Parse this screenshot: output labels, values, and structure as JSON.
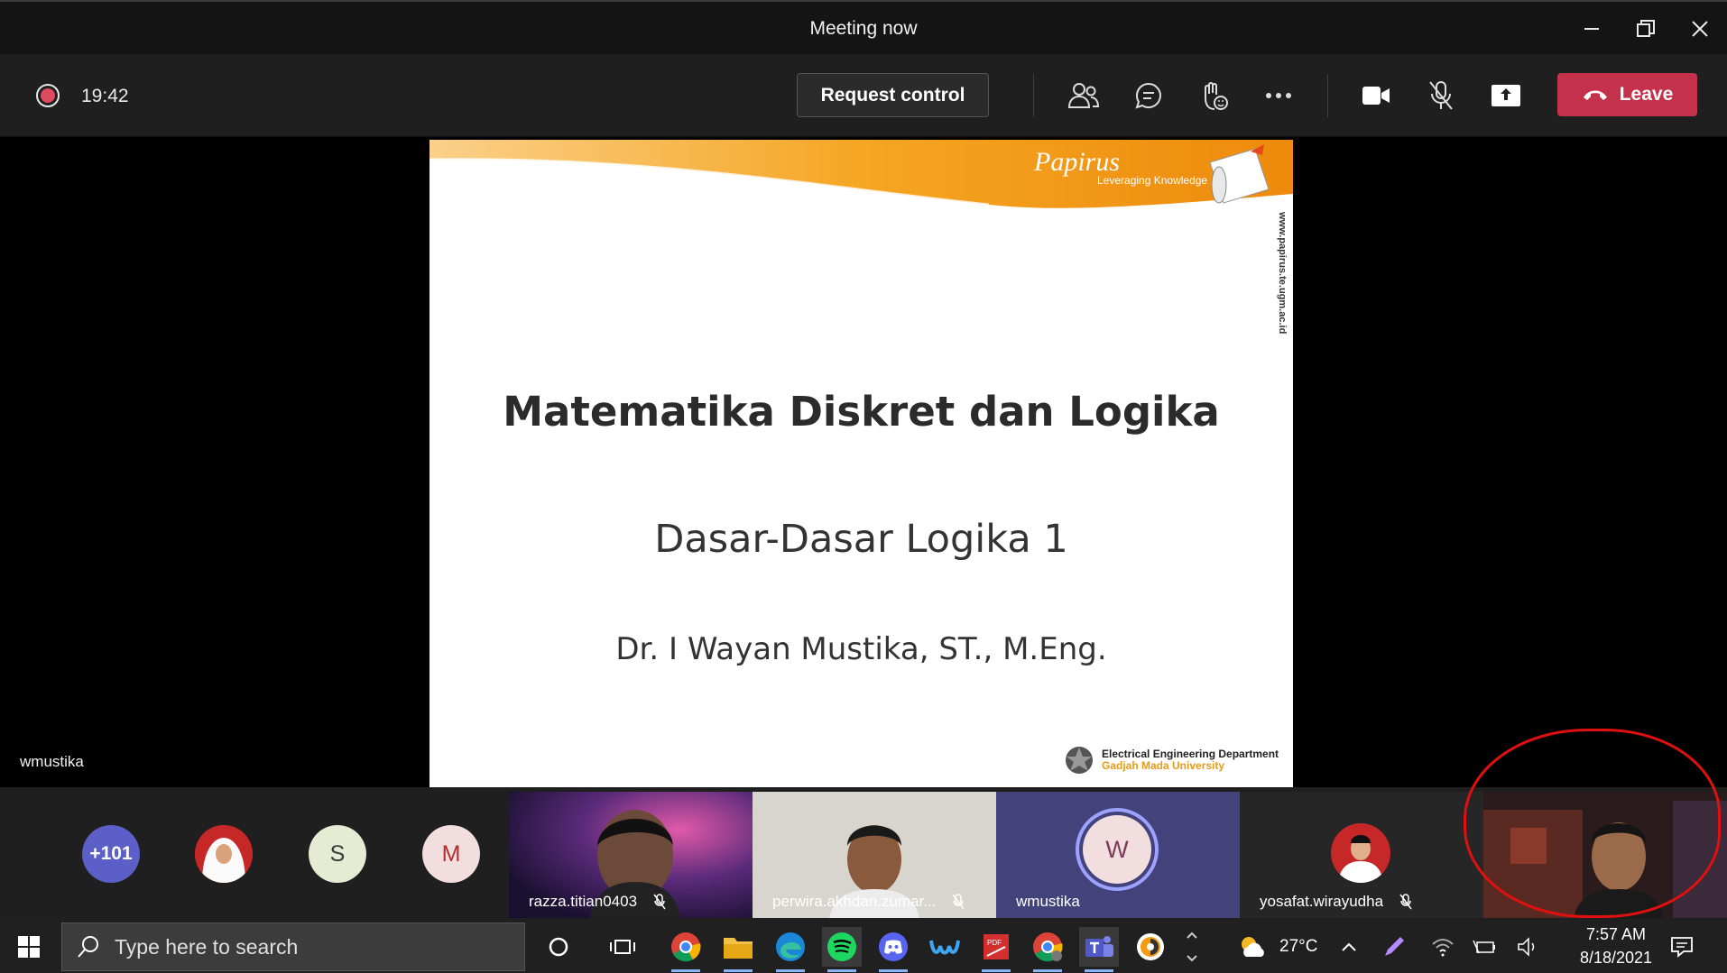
{
  "window": {
    "title": "Meeting now"
  },
  "toolbar": {
    "elapsed": "19:42",
    "request_control_label": "Request control",
    "leave_label": "Leave"
  },
  "stage": {
    "presenter_name": "wmustika",
    "slide": {
      "brand_name": "Papirus",
      "brand_tagline": "Leveraging Knowledge",
      "url": "www.papirus.te.ugm.ac.id",
      "title": "Matematika Diskret dan Logika",
      "subtitle": "Dasar-Dasar Logika 1",
      "author": "Dr. I Wayan Mustika, ST., M.Eng.",
      "department": "Electrical Engineering Department",
      "university": "Gadjah Mada University"
    }
  },
  "participants": {
    "overflow_count": "+101",
    "avatars": [
      {
        "initial": "S",
        "bg": "#e6ebd3",
        "fg": "#3b3b3b"
      },
      {
        "initial": "M",
        "bg": "#f2dede",
        "fg": "#b03030"
      }
    ],
    "tiles": [
      {
        "name": "razza.titian0403"
      },
      {
        "name": "perwira.akhdan.zumar..."
      },
      {
        "name": "wmustika",
        "initial": "W"
      },
      {
        "name": "yosafat.wirayudha"
      }
    ]
  },
  "taskbar": {
    "search_placeholder": "Type here to search",
    "weather": "27°C",
    "time": "7:57 AM",
    "date": "8/18/2021"
  },
  "colors": {
    "leave": "#c4314b",
    "accent_orange": "#f29a1a",
    "highlight": "#e01010"
  }
}
